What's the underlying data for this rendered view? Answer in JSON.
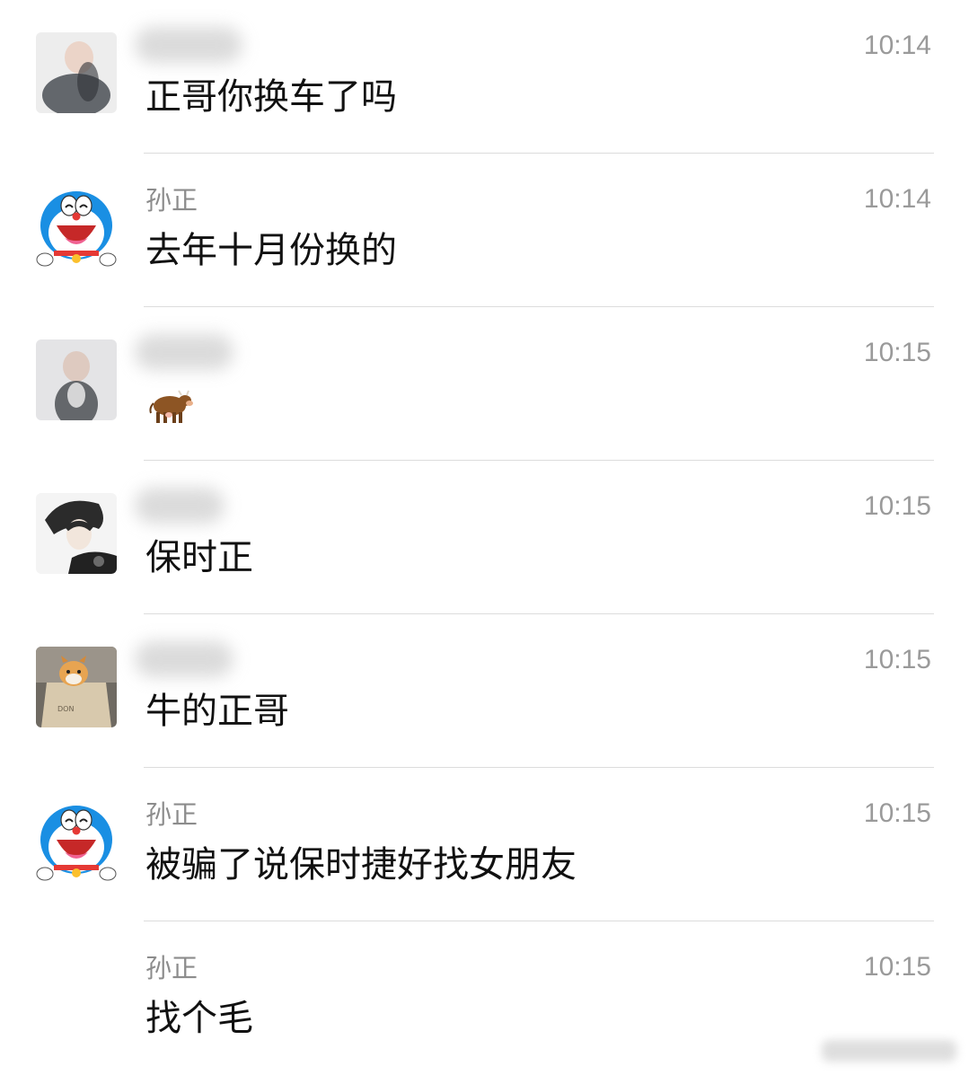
{
  "messages": [
    {
      "sender": "",
      "time": "10:14",
      "text": "正哥你换车了吗",
      "avatar": "blurred-photo-avatar"
    },
    {
      "sender": "孙正",
      "time": "10:14",
      "text": "去年十月份换的",
      "avatar": "doraemon-avatar"
    },
    {
      "sender": "",
      "time": "10:15",
      "text": "",
      "emoji": "cow-emoji",
      "avatar": "blurred-photo-avatar"
    },
    {
      "sender": "",
      "time": "10:15",
      "text": "保时正",
      "avatar": "anime-boy-avatar"
    },
    {
      "sender": "",
      "time": "10:15",
      "text": "牛的正哥",
      "avatar": "shiba-dog-avatar"
    },
    {
      "sender": "孙正",
      "time": "10:15",
      "text": "被骗了说保时捷好找女朋友",
      "avatar": "doraemon-avatar"
    },
    {
      "sender": "孙正",
      "time": "10:15",
      "text": "找个毛",
      "avatar": ""
    }
  ],
  "colors": {
    "background": "#ffffff",
    "text": "#111111",
    "sender": "#8c8c8c",
    "time": "#9a9a9a",
    "divider": "#dcdcdc",
    "doraemon_blue": "#1a8fe3"
  }
}
